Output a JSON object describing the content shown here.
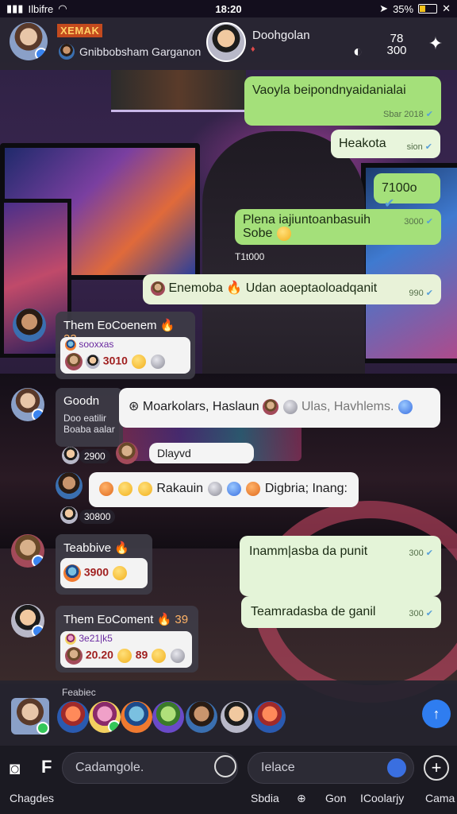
{
  "status_bar": {
    "carrier": "Ilbifre",
    "time": "18:20",
    "battery": "35%",
    "battery_level": 0.35
  },
  "header": {
    "brand": "XEMAK",
    "subtitle": "Gnibbobsham Garganon",
    "contact_name": "Doohgolan",
    "more_line1": "78",
    "more_line2": "300"
  },
  "messages": {
    "m1": {
      "text": "Vaoyla beipondnyaidanialai",
      "meta": "Sbar 2018"
    },
    "m2": {
      "text": "Heakota",
      "meta": "sion"
    },
    "m3": {
      "text": "7100o"
    },
    "m4": {
      "text": "Plena iajiuntoanbasuih",
      "text2": "Sobe",
      "meta": "3000"
    },
    "ts1": "T1t000",
    "m5": {
      "text": "Enemoba 🔥 Udan aoeptaoloadqanit",
      "meta": "990"
    },
    "card1": {
      "title": "Them EoCoenem",
      "badge": "23",
      "tag": "sooxxas",
      "value": "3010"
    },
    "card2": {
      "title": "Goodn",
      "sub1": "Doo eatilir",
      "sub2": "Boaba aalar"
    },
    "m6": {
      "text": "Moarkolars, Haslaun",
      "text2": "Ulas, Havhlems."
    },
    "label1": "2900",
    "m7": {
      "text": "Dlayvd"
    },
    "m8": {
      "text": "Rakauin",
      "text2": "Digbria; Inang:"
    },
    "label2": "30800",
    "card3": {
      "title": "Teabbive",
      "value": "3900"
    },
    "m9": {
      "text": "Inamm|asba da punit",
      "meta": "300"
    },
    "card4": {
      "title": "Them EoComent",
      "badge": "39",
      "tag": "3e21|k5",
      "value": "20.20",
      "extra": "89"
    },
    "m10": {
      "text": "Teamradasba de ganil",
      "meta": "300"
    }
  },
  "favorites": {
    "title": "Feabiec"
  },
  "input": {
    "field1_placeholder": "Cadamgole.",
    "field2_placeholder": "Ielace"
  },
  "tabs": [
    "Chagdes",
    "Sbdia",
    "Gon",
    "ICoolarjy",
    "Cama"
  ],
  "colors": {
    "outgoing_bubble": "#a4e07a",
    "incoming_bubble": "#f4f4f4",
    "accent": "#2f7df0",
    "header_bg": "#28262f"
  }
}
